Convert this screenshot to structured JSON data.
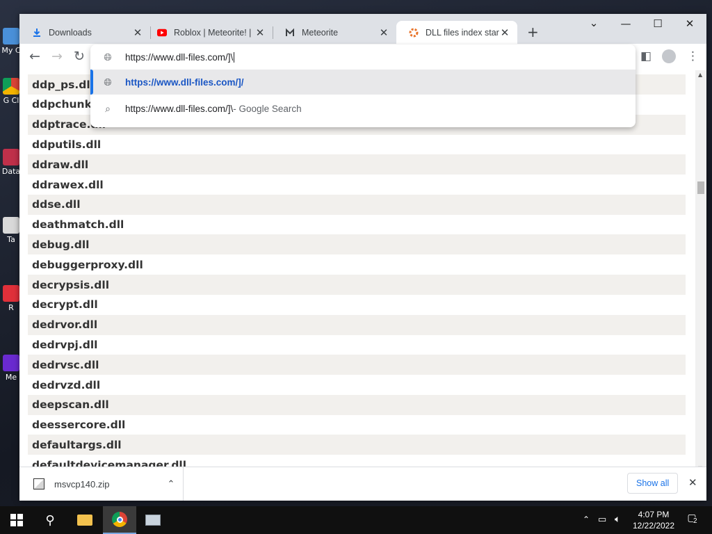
{
  "desktop": {
    "icons": [
      {
        "label": "My C"
      },
      {
        "label": "G Cl"
      },
      {
        "label": "Data"
      },
      {
        "label": "Ta"
      },
      {
        "label": "R"
      },
      {
        "label": "Me"
      }
    ]
  },
  "tabs": [
    {
      "title": "Downloads",
      "icon": "download-icon",
      "active": false
    },
    {
      "title": "Roblox | Meteorite! |",
      "icon": "youtube-icon",
      "active": false
    },
    {
      "title": "Meteorite",
      "icon": "gamepad-icon",
      "active": false
    },
    {
      "title": "DLL files index startir",
      "icon": "dll-files-icon",
      "active": true
    }
  ],
  "toolbar": {
    "address_value": "https://www.dll-files.com/]\\"
  },
  "omnibox": {
    "suggestions": [
      {
        "text": "https://www.dll-files.com/]/",
        "suffix": "",
        "icon": "globe-icon",
        "selected": true
      },
      {
        "text": "https://www.dll-files.com/]\\",
        "suffix": " - Google Search",
        "icon": "search-icon",
        "selected": false
      }
    ]
  },
  "page": {
    "dll_files": [
      "ddp_ps.dll",
      "ddpchunk.dll",
      "ddptrace.dll",
      "ddputils.dll",
      "ddraw.dll",
      "ddrawex.dll",
      "ddse.dll",
      "deathmatch.dll",
      "debug.dll",
      "debuggerproxy.dll",
      "decrypsis.dll",
      "decrypt.dll",
      "dedrvor.dll",
      "dedrvpj.dll",
      "dedrvsc.dll",
      "dedrvzd.dll",
      "deepscan.dll",
      "deessercore.dll",
      "defaultargs.dll",
      "defaultdevicemanager.dll"
    ]
  },
  "download_shelf": {
    "file_name": "msvcp140.zip",
    "show_all_label": "Show all"
  },
  "taskbar": {
    "time": "4:07 PM",
    "date": "12/22/2022",
    "notification_count": "2"
  },
  "colors": {
    "accent": "#1a73e8",
    "link": "#1a56c4",
    "row_alt": "#f2f0ed",
    "youtube_red": "#ff0000",
    "dll_orange": "#e8742a"
  }
}
